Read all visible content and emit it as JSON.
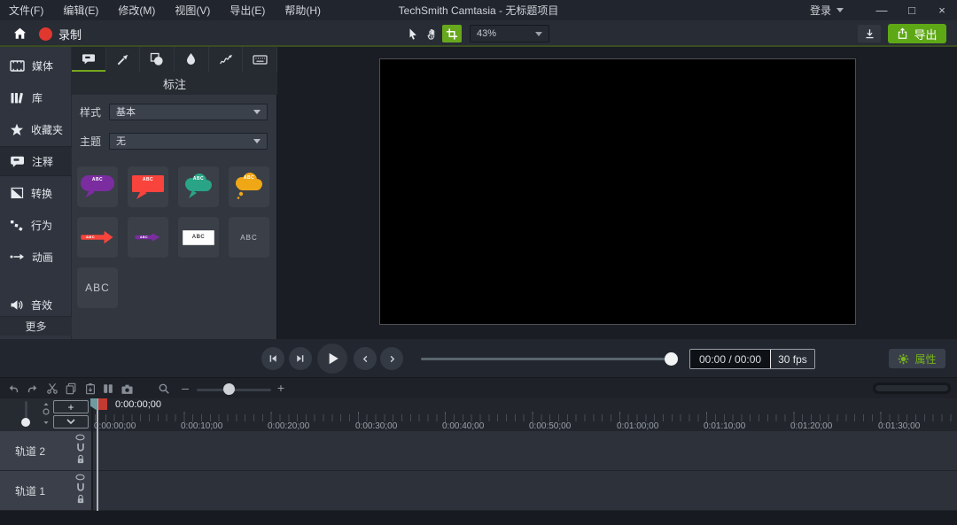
{
  "window": {
    "title": "TechSmith Camtasia - 无标题项目",
    "login_label": "登录",
    "controls": {
      "minimize": "—",
      "maximize": "□",
      "close": "×"
    }
  },
  "menubar": {
    "items": [
      "文件(F)",
      "编辑(E)",
      "修改(M)",
      "视图(V)",
      "导出(E)",
      "帮助(H)"
    ]
  },
  "toolbar": {
    "record_label": "录制",
    "zoom_value": "43%",
    "export_label": "导出"
  },
  "sidebar": {
    "items": [
      {
        "label": "媒体"
      },
      {
        "label": "库"
      },
      {
        "label": "收藏夹"
      },
      {
        "label": "注释"
      },
      {
        "label": "转换"
      },
      {
        "label": "行为"
      },
      {
        "label": "动画"
      },
      {
        "label": "音效"
      }
    ],
    "more_label": "更多"
  },
  "panel": {
    "title": "标注",
    "style_label": "样式",
    "style_value": "基本",
    "theme_label": "主题",
    "theme_value": "无",
    "callouts": [
      {
        "name": "rounded-speech-bubble",
        "color": "#7b2da0",
        "label": "ABC"
      },
      {
        "name": "rect-speech-bubble",
        "color": "#f8443c",
        "label": "ABC"
      },
      {
        "name": "cloud-speech",
        "color": "#2aa486",
        "label": "ABC"
      },
      {
        "name": "thought-cloud",
        "color": "#f0a716",
        "label": "ABC"
      },
      {
        "name": "arrow-red",
        "color": "#f8443c",
        "label": "ABC"
      },
      {
        "name": "arrow-purple",
        "color": "#7b2da0",
        "label": "ABC"
      },
      {
        "name": "white-text-box",
        "color": "#ffffff",
        "label": "ABC"
      },
      {
        "name": "plain-text",
        "color": "",
        "label": "ABC"
      },
      {
        "name": "plain-text-large",
        "color": "",
        "label": "ABC"
      }
    ]
  },
  "playback": {
    "time_display": "00:00 / 00:00",
    "fps": "30 fps",
    "properties_label": "属性"
  },
  "timeline": {
    "playhead_time": "0:00:00;00",
    "add_track_label": "+",
    "ruler": [
      "0:00:00;00",
      "0:00:10;00",
      "0:00:20;00",
      "0:00:30;00",
      "0:00:40;00",
      "0:00:50;00",
      "0:01:00;00",
      "0:01:10;00",
      "0:01:20;00",
      "0:01:30;00"
    ],
    "tracks": [
      {
        "name": "轨道 2"
      },
      {
        "name": "轨道 1"
      }
    ]
  },
  "colors": {
    "accent_green": "#5ea816",
    "tab_underline_green": "#76a71c",
    "record_red": "#e0382f",
    "playhead_red": "#c23a32",
    "playhead_teal": "#6f9ba1"
  }
}
